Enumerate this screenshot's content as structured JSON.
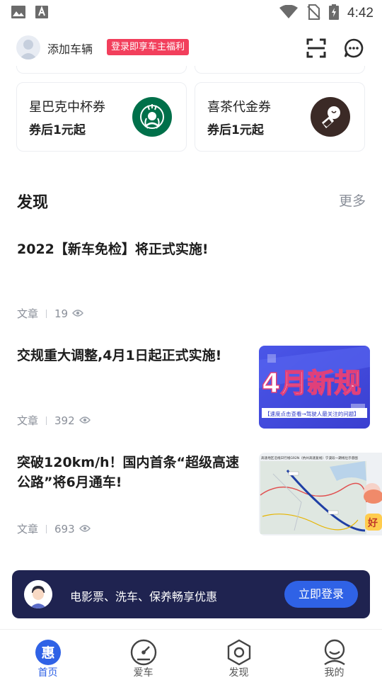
{
  "status_bar": {
    "time": "4:42",
    "icons": [
      "image-icon",
      "font-icon",
      "wifi-icon",
      "no-sim-icon",
      "battery-charging-icon"
    ]
  },
  "header": {
    "add_vehicle": "添加车辆",
    "promo_badge": "登录即享车主福利",
    "icons": [
      "avatar-icon",
      "scan-icon",
      "message-icon"
    ]
  },
  "coupons": [
    {
      "title": "星巴克中杯券",
      "subtitle": "券后1元起",
      "logo": "starbucks-logo"
    },
    {
      "title": "喜茶代金券",
      "subtitle": "券后1元起",
      "logo": "heytea-logo"
    }
  ],
  "discover": {
    "title": "发现",
    "more": "更多"
  },
  "articles": [
    {
      "title": "2022【新车免检】将正式实施!",
      "type": "文章",
      "views": "19"
    },
    {
      "title": "交规重大调整,4月1日起正式实施!",
      "type": "文章",
      "views": "392",
      "thumb": {
        "headline": "4月新规",
        "caption": "【速度点击查看→驾驶人最关注的问题】"
      }
    },
    {
      "title_line1": "突破120km/h！国内首条“超级高速",
      "title_line2": "公路”将6月通车!",
      "type": "文章",
      "views": "693",
      "thumb": {
        "map_caption": "高速地区沿线日行线G92N（杭州高速复线）宁波段一期线位示意图",
        "sticker": "好"
      }
    }
  ],
  "login_banner": {
    "text": "电影票、洗车、保养畅享优惠",
    "button": "立即登录"
  },
  "bottom_nav": [
    {
      "label": "首页",
      "icon": "home-hui-icon",
      "active": true,
      "icon_char": "惠"
    },
    {
      "label": "爱车",
      "icon": "speedometer-icon",
      "active": false
    },
    {
      "label": "发现",
      "icon": "discover-hexagon-icon",
      "active": false
    },
    {
      "label": "我的",
      "icon": "profile-icon",
      "active": false
    }
  ],
  "colors": {
    "accent": "#2f62e6",
    "badge": "#f23f5c",
    "banner": "#1f2350",
    "muted": "#8a8f99"
  }
}
